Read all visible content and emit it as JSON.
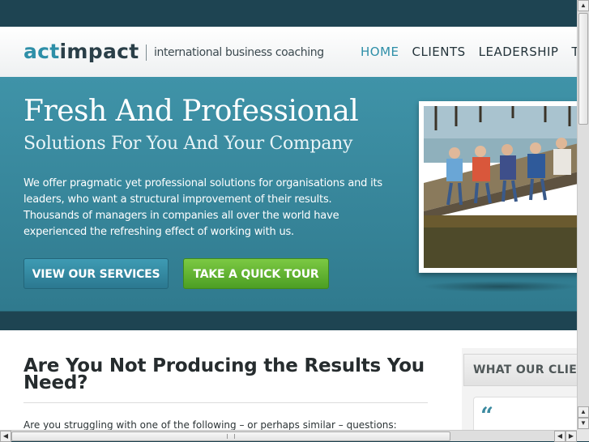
{
  "header": {
    "logo_part1": "act",
    "logo_part2": "impact",
    "tagline": "international business coaching",
    "nav": [
      "HOME",
      "CLIENTS",
      "LEADERSHIP",
      "T"
    ]
  },
  "hero": {
    "title": "Fresh And Professional",
    "subtitle": "Solutions For You And Your Company",
    "body": "We offer pragmatic yet professional solutions for organisations and its leaders, who want a structural improvement of their results. Thousands of managers in companies all over the world have experienced the refreshing effect of working with us.",
    "button_services": "VIEW OUR SERVICES",
    "button_tour": "TAKE A QUICK TOUR"
  },
  "content": {
    "heading": "Are You Not Producing the Results You Need?",
    "question": "Are you struggling with one of the following – or perhaps similar – questions:"
  },
  "sidebar": {
    "title": "WHAT OUR CLIENTS",
    "quote_mark": "“"
  },
  "scrollbars": {
    "up_arrow": "▲",
    "down_arrow": "▼",
    "left_arrow": "◀",
    "right_arrow": "▶"
  },
  "colors": {
    "brand_blue": "#2e8fa8",
    "hero_bg": "#3f93a8",
    "tour_green": "#5fb22f",
    "dark_bg": "#1e4452"
  }
}
